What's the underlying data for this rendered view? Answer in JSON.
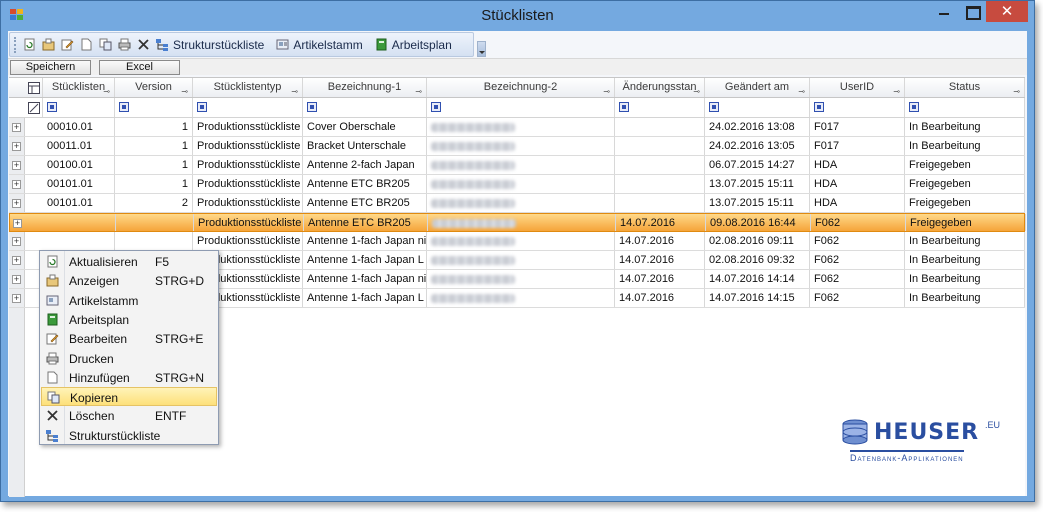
{
  "window": {
    "title": "Stücklisten",
    "close_glyph": "✕"
  },
  "toolbar": {
    "items": [
      {
        "icon": "refresh-icon"
      },
      {
        "icon": "view-icon"
      },
      {
        "icon": "edit-icon"
      },
      {
        "icon": "new-icon"
      },
      {
        "icon": "copy-icon"
      },
      {
        "icon": "print-icon"
      },
      {
        "icon": "delete-icon"
      }
    ],
    "struktur_label": "Strukturstückliste",
    "artikel_label": "Artikelstamm",
    "arbeitsplan_label": "Arbeitsplan"
  },
  "buttons": {
    "save_label": "Speichern",
    "excel_label": "Excel"
  },
  "grid": {
    "columns": [
      {
        "label": "Stücklisten",
        "pin": "⊸"
      },
      {
        "label": "Version",
        "pin": "⊸"
      },
      {
        "label": "Stücklistentyp",
        "pin": "⊸"
      },
      {
        "label": "Bezeichnung-1",
        "pin": "⊸"
      },
      {
        "label": "Bezeichnung-2",
        "pin": "⊸"
      },
      {
        "label": "Änderungsstan",
        "pin": "⊸"
      },
      {
        "label": "Geändert am",
        "pin": "⊸"
      },
      {
        "label": "UserID",
        "pin": "⊸"
      },
      {
        "label": "Status",
        "pin": "⊸"
      }
    ],
    "rows": [
      {
        "nr": "00010.01",
        "version": "1",
        "typ": "Produktionsstückliste",
        "bez1": "Cover Oberschale",
        "aenderung": "",
        "geaendert": "24.02.2016 13:08",
        "user": "F017",
        "status": "In Bearbeitung"
      },
      {
        "nr": "00011.01",
        "version": "1",
        "typ": "Produktionsstückliste",
        "bez1": "Bracket Unterschale",
        "aenderung": "",
        "geaendert": "24.02.2016 13:05",
        "user": "F017",
        "status": "In Bearbeitung"
      },
      {
        "nr": "00100.01",
        "version": "1",
        "typ": "Produktionsstückliste",
        "bez1": "Antenne 2-fach Japan",
        "aenderung": "",
        "geaendert": "06.07.2015 14:27",
        "user": "HDA",
        "status": "Freigegeben"
      },
      {
        "nr": "00101.01",
        "version": "1",
        "typ": "Produktionsstückliste",
        "bez1": "Antenne ETC BR205",
        "aenderung": "",
        "geaendert": "13.07.2015 15:11",
        "user": "HDA",
        "status": "Freigegeben"
      },
      {
        "nr": "00101.01",
        "version": "2",
        "typ": "Produktionsstückliste",
        "bez1": "Antenne ETC BR205",
        "aenderung": "",
        "geaendert": "13.07.2015 15:11",
        "user": "HDA",
        "status": "Freigegeben"
      },
      {
        "nr": "",
        "version": "",
        "typ": "Produktionsstückliste",
        "bez1": "Antenne ETC BR205",
        "aenderung": "14.07.2016",
        "geaendert": "09.08.2016 16:44",
        "user": "F062",
        "status": "Freigegeben"
      },
      {
        "nr": "",
        "version": "",
        "typ": "Produktionsstückliste",
        "bez1": "Antenne 1-fach Japan ni",
        "aenderung": "14.07.2016",
        "geaendert": "02.08.2016 09:11",
        "user": "F062",
        "status": "In Bearbeitung"
      },
      {
        "nr": "",
        "version": "",
        "typ": "Produktionsstückliste",
        "bez1": "Antenne 1-fach Japan L",
        "aenderung": "14.07.2016",
        "geaendert": "02.08.2016 09:32",
        "user": "F062",
        "status": "In Bearbeitung"
      },
      {
        "nr": "",
        "version": "",
        "typ": "Produktionsstückliste",
        "bez1": "Antenne 1-fach Japan ni",
        "aenderung": "14.07.2016",
        "geaendert": "14.07.2016 14:14",
        "user": "F062",
        "status": "In Bearbeitung"
      },
      {
        "nr": "",
        "version": "",
        "typ": "Produktionsstückliste",
        "bez1": "Antenne 1-fach Japan L",
        "aenderung": "14.07.2016",
        "geaendert": "14.07.2016 14:15",
        "user": "F062",
        "status": "In Bearbeitung"
      }
    ],
    "selected_row": 5,
    "expander_glyph": "+"
  },
  "context_menu": {
    "items": [
      {
        "label": "Aktualisieren",
        "shortcut": "F5",
        "icon": "refresh-icon"
      },
      {
        "label": "Anzeigen",
        "shortcut": "STRG+D",
        "icon": "view-icon"
      },
      {
        "label": "Artikelstamm",
        "shortcut": "",
        "icon": "article-icon"
      },
      {
        "label": "Arbeitsplan",
        "shortcut": "",
        "icon": "book-icon"
      },
      {
        "label": "Bearbeiten",
        "shortcut": "STRG+E",
        "icon": "edit-icon"
      },
      {
        "label": "Drucken",
        "shortcut": "",
        "icon": "print-icon"
      },
      {
        "label": "Hinzufügen",
        "shortcut": "STRG+N",
        "icon": "new-icon"
      },
      {
        "label": "Kopieren",
        "shortcut": "",
        "icon": "copy-icon"
      },
      {
        "label": "Löschen",
        "shortcut": "ENTF",
        "icon": "delete-icon"
      },
      {
        "label": "Strukturstückliste",
        "shortcut": "",
        "icon": "structure-icon"
      }
    ],
    "highlighted": 7
  },
  "logo": {
    "name": "HEUSER",
    "suffix": ".EU",
    "tagline": "Datenbank-Applikationen"
  },
  "colors": {
    "titlebar": "#74a9e0",
    "selection": "#f5a43a",
    "close_button": "#c74b3f",
    "logo": "#2a4ea0"
  }
}
